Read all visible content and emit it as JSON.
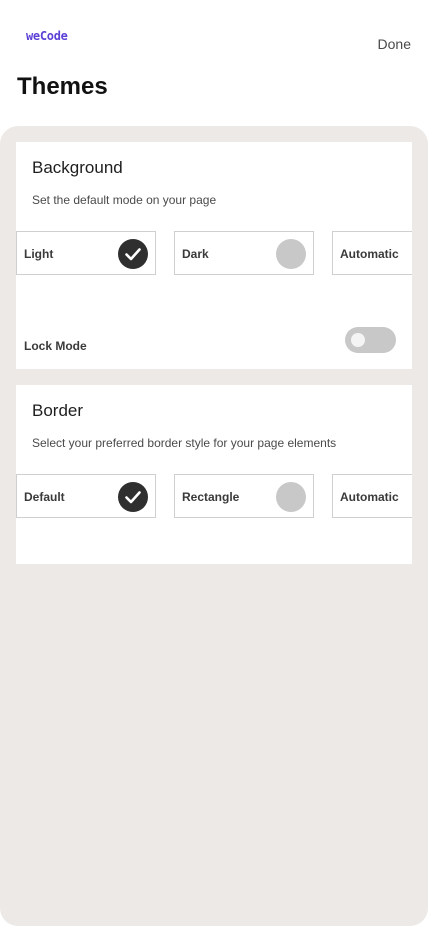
{
  "header": {
    "logo_text": "weCode",
    "done_label": "Done",
    "title": "Themes"
  },
  "background": {
    "title": "Background",
    "subtitle": "Set the default mode on your page",
    "options": [
      {
        "label": "Light",
        "selected": true
      },
      {
        "label": "Dark",
        "selected": false
      },
      {
        "label": "Automatic",
        "selected": false
      }
    ],
    "lock_label": "Lock Mode",
    "lock_enabled": false
  },
  "border": {
    "title": "Border",
    "subtitle": "Select your preferred border style for your page elements",
    "options": [
      {
        "label": "Default",
        "selected": true
      },
      {
        "label": "Rectangle",
        "selected": false
      },
      {
        "label": "Automatic",
        "selected": false
      }
    ]
  },
  "colors": {
    "accent": "#5b3fd6",
    "panel": "#ede9e7",
    "selected": "#2f2f2f",
    "unselected": "#c8c8c8"
  }
}
